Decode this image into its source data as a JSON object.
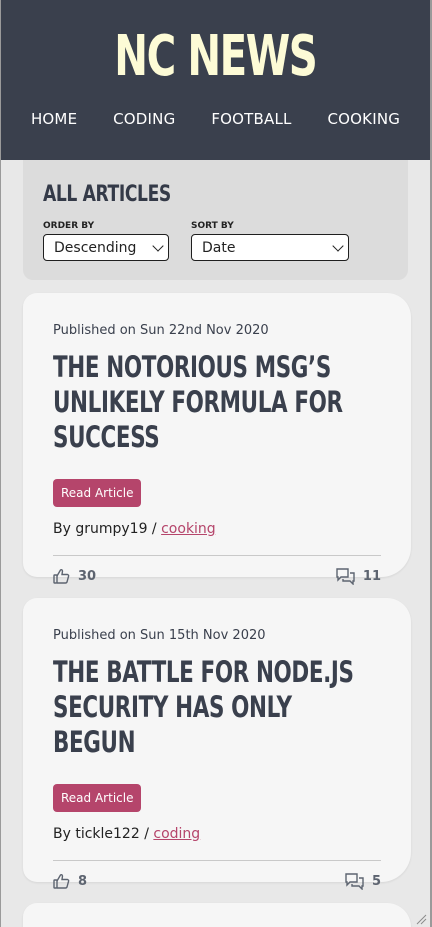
{
  "header": {
    "site_title": "NC NEWS",
    "nav": [
      "HOME",
      "CODING",
      "FOOTBALL",
      "COOKING"
    ]
  },
  "filters": {
    "panel_title": "ALL ARTICLES",
    "order_label": "ORDER BY",
    "order_value": "Descending",
    "sort_label": "SORT BY",
    "sort_value": "Date"
  },
  "articles": [
    {
      "published": "Published on Sun 22nd Nov 2020",
      "title": "THE NOTORIOUS MSG’S UNLIKELY FORMULA FOR SUCCESS",
      "button": "Read Article",
      "author_prefix": "By grumpy19 /",
      "topic": "cooking",
      "votes": "30",
      "comments": "11"
    },
    {
      "published": "Published on Sun 15th Nov 2020",
      "title": "THE BATTLE FOR NODE.JS SECURITY HAS ONLY BEGUN",
      "button": "Read Article",
      "author_prefix": "By tickle122 /",
      "topic": "coding",
      "votes": "8",
      "comments": "5"
    }
  ],
  "colors": {
    "header_bg": "#3a404d",
    "title_color": "#fdfbd6",
    "accent": "#b5456b",
    "card_bg": "#f6f6f6",
    "page_bg": "#e8e8e8"
  },
  "icons": {
    "votes": "thumbs-up-icon",
    "comments": "comments-icon",
    "select": "chevron-down-icon"
  }
}
